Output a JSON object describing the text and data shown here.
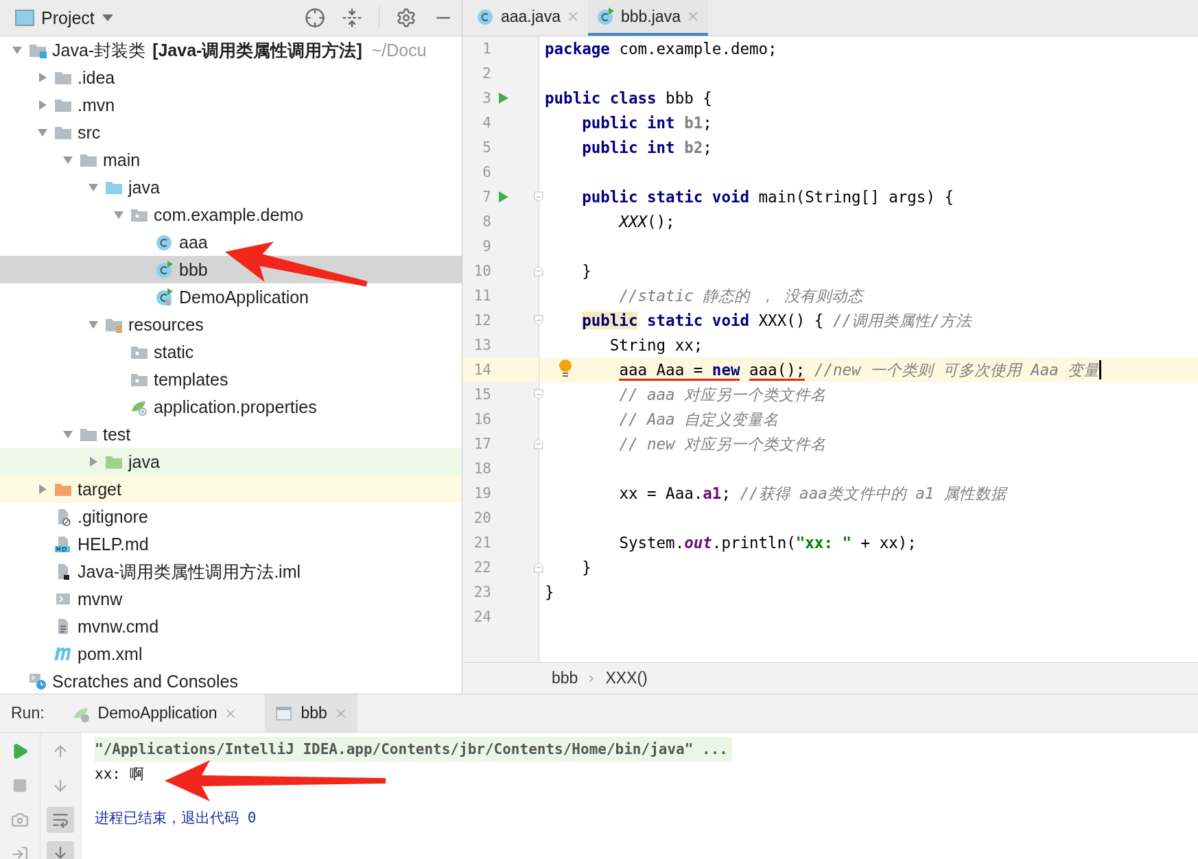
{
  "project_panel": {
    "title": "Project",
    "tree": [
      {
        "label": "Java-封装类",
        "module": "[Java-调用类属性调用方法]",
        "path": "~/Docu",
        "kind": "module",
        "expanded": true,
        "selected": false,
        "children": [
          {
            "label": ".idea",
            "kind": "folder",
            "expanded": false,
            "selected": false
          },
          {
            "label": ".mvn",
            "kind": "folder",
            "expanded": false,
            "selected": false
          },
          {
            "label": "src",
            "kind": "folder",
            "expanded": true,
            "selected": false,
            "children": [
              {
                "label": "main",
                "kind": "folder",
                "expanded": true,
                "selected": false,
                "children": [
                  {
                    "label": "java",
                    "kind": "source-folder",
                    "expanded": true,
                    "selected": false,
                    "children": [
                      {
                        "label": "com.example.demo",
                        "kind": "package",
                        "expanded": true,
                        "selected": false,
                        "children": [
                          {
                            "label": "aaa",
                            "kind": "class",
                            "selected": false
                          },
                          {
                            "label": "bbb",
                            "kind": "runnable-class",
                            "selected": true
                          },
                          {
                            "label": "DemoApplication",
                            "kind": "spring-class",
                            "selected": false
                          }
                        ]
                      }
                    ]
                  },
                  {
                    "label": "resources",
                    "kind": "resources-folder",
                    "expanded": true,
                    "selected": false,
                    "children": [
                      {
                        "label": "static",
                        "kind": "package",
                        "selected": false
                      },
                      {
                        "label": "templates",
                        "kind": "package",
                        "selected": false
                      },
                      {
                        "label": "application.properties",
                        "kind": "spring-properties",
                        "selected": false
                      }
                    ]
                  }
                ]
              },
              {
                "label": "test",
                "kind": "folder",
                "expanded": true,
                "selected": false,
                "children": [
                  {
                    "label": "java",
                    "kind": "test-folder",
                    "expanded": false,
                    "selected": false
                  }
                ]
              }
            ]
          },
          {
            "label": "target",
            "kind": "excluded-folder",
            "expanded": false,
            "selected": false
          },
          {
            "label": ".gitignore",
            "kind": "ignore-file",
            "selected": false
          },
          {
            "label": "HELP.md",
            "kind": "markdown-file",
            "selected": false
          },
          {
            "label": "Java-调用类属性调用方法.iml",
            "kind": "module-file",
            "selected": false
          },
          {
            "label": "mvnw",
            "kind": "script-file",
            "selected": false
          },
          {
            "label": "mvnw.cmd",
            "kind": "text-file",
            "selected": false
          },
          {
            "label": "pom.xml",
            "kind": "maven-file",
            "selected": false
          }
        ]
      },
      {
        "label": "Scratches and Consoles",
        "kind": "scratches",
        "selected": false
      }
    ]
  },
  "editor": {
    "tabs": [
      {
        "label": "aaa.java",
        "kind": "class",
        "selected": false
      },
      {
        "label": "bbb.java",
        "kind": "runnable-class",
        "selected": true
      }
    ],
    "lines": [
      {
        "number": "1",
        "tokens": [
          {
            "kind": "keyword",
            "text": "package"
          },
          {
            "kind": "plain",
            "text": " com.example.demo;"
          }
        ]
      },
      {
        "number": "2"
      },
      {
        "number": "3",
        "run": true,
        "tokens": [
          {
            "kind": "keyword",
            "text": "public class"
          },
          {
            "kind": "plain",
            "text": " bbb {"
          }
        ]
      },
      {
        "number": "4",
        "tokens": [
          {
            "kind": "keyword",
            "text": "    public int"
          },
          {
            "kind": "unused-field",
            "text": " b1"
          },
          {
            "kind": "plain",
            "text": ";"
          }
        ]
      },
      {
        "number": "5",
        "tokens": [
          {
            "kind": "keyword",
            "text": "    public int"
          },
          {
            "kind": "unused-field",
            "text": " b2"
          },
          {
            "kind": "plain",
            "text": ";"
          }
        ]
      },
      {
        "number": "6"
      },
      {
        "number": "7",
        "run": true,
        "fold_start": true,
        "tokens": [
          {
            "kind": "keyword",
            "text": "    public static void"
          },
          {
            "kind": "plain",
            "text": " main(String[] args) {"
          }
        ]
      },
      {
        "number": "8",
        "tokens": [
          {
            "kind": "static-call",
            "text": "        XXX"
          },
          {
            "kind": "plain",
            "text": "();"
          }
        ]
      },
      {
        "number": "9"
      },
      {
        "number": "10",
        "fold_end": true,
        "tokens": [
          {
            "kind": "plain",
            "text": "    }"
          }
        ]
      },
      {
        "number": "11",
        "tokens": [
          {
            "kind": "comment",
            "text": "        //static 静态的 ， 没有则动态"
          }
        ]
      },
      {
        "number": "12",
        "fold_start": true,
        "tokens": [
          {
            "kind": "keyword-match",
            "text": "    public"
          },
          {
            "kind": "keyword",
            "text": " static void"
          },
          {
            "kind": "plain",
            "text": " XXX() {"
          },
          {
            "kind": "comment",
            "text": " //调用类属性/方法"
          }
        ]
      },
      {
        "number": "13",
        "tokens": [
          {
            "kind": "plain",
            "text": "       String xx;"
          }
        ]
      },
      {
        "number": "14",
        "current": true,
        "bulb": true,
        "caret": true,
        "tokens": [
          {
            "kind": "plain",
            "text": "        aaa Aaa = ",
            "underlined": true
          },
          {
            "kind": "keyword",
            "text": "new",
            "underlined": true
          },
          {
            "kind": "plain",
            "text": " aaa();",
            "underlined": true
          },
          {
            "kind": "comment",
            "text": " //new 一个类则 可多次使用 Aaa 变量"
          }
        ]
      },
      {
        "number": "15",
        "fold_start": true,
        "tokens": [
          {
            "kind": "comment",
            "text": "        // aaa 对应另一个类文件名"
          }
        ]
      },
      {
        "number": "16",
        "tokens": [
          {
            "kind": "comment",
            "text": "        // Aaa 自定义变量名"
          }
        ]
      },
      {
        "number": "17",
        "fold_end": true,
        "tokens": [
          {
            "kind": "comment",
            "text": "        // new 对应另一个类文件名"
          }
        ]
      },
      {
        "number": "18"
      },
      {
        "number": "19",
        "tokens": [
          {
            "kind": "plain",
            "text": "        xx = Aaa."
          },
          {
            "kind": "field",
            "text": "a1"
          },
          {
            "kind": "plain",
            "text": ";"
          },
          {
            "kind": "comment",
            "text": " //获得 aaa类文件中的 a1 属性数据"
          }
        ]
      },
      {
        "number": "20"
      },
      {
        "number": "21",
        "tokens": [
          {
            "kind": "plain",
            "text": "        System."
          },
          {
            "kind": "static-field",
            "text": "out"
          },
          {
            "kind": "plain",
            "text": ".println("
          },
          {
            "kind": "string",
            "text": "\"xx: \""
          },
          {
            "kind": "plain",
            "text": " + xx);"
          }
        ]
      },
      {
        "number": "22",
        "fold_end": true,
        "tokens": [
          {
            "kind": "plain",
            "text": "    }"
          }
        ]
      },
      {
        "number": "23",
        "tokens": [
          {
            "kind": "plain",
            "text": "}"
          }
        ]
      },
      {
        "number": "24"
      }
    ],
    "breadcrumbs": [
      "bbb",
      "XXX()"
    ]
  },
  "run_panel": {
    "label": "Run:",
    "tabs": [
      {
        "label": "DemoApplication",
        "kind": "spring-app",
        "selected": false
      },
      {
        "label": "bbb",
        "kind": "app-window",
        "selected": true
      }
    ],
    "console": [
      {
        "kind": "command",
        "text": "\"/Applications/IntelliJ IDEA.app/Contents/jbr/Contents/Home/bin/java\" ..."
      },
      {
        "kind": "output",
        "text": "xx: 啊"
      },
      {
        "kind": "exit",
        "text": "进程已结束，退出代码 0"
      }
    ]
  }
}
